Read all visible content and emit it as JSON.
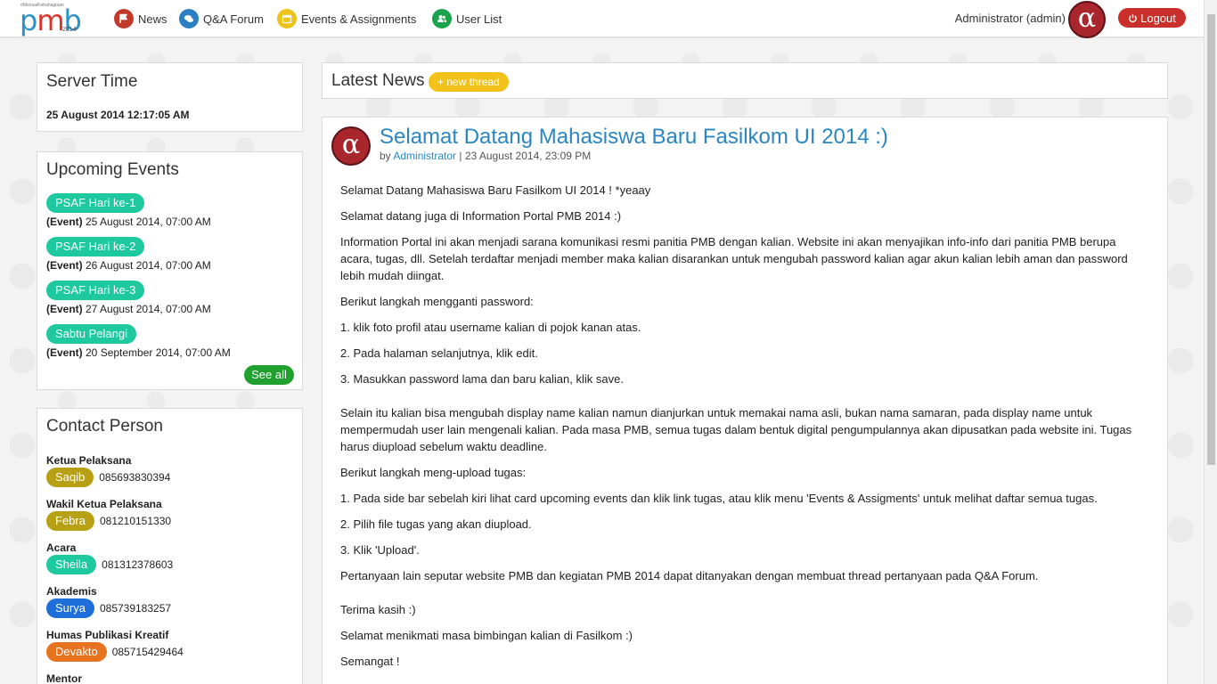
{
  "nav": {
    "logo_tagline": "#MenuaiKebahagiaan",
    "logo_p": "p",
    "logo_m": "m",
    "logo_b": "b",
    "logo_year": "2014",
    "items": [
      {
        "label": "News",
        "icon": "flag-icon"
      },
      {
        "label": "Q&A Forum",
        "icon": "chat-bubbles-icon"
      },
      {
        "label": "Events & Assignments",
        "icon": "calendar-icon"
      },
      {
        "label": "User List",
        "icon": "users-icon"
      }
    ],
    "admin_name": "Administrator (admin)",
    "avatar_glyph": "α",
    "logout_label": "Logout"
  },
  "server_time": {
    "title": "Server Time",
    "value": "25 August 2014 12:17:05 AM"
  },
  "events": {
    "title": "Upcoming Events",
    "items": [
      {
        "name": "PSAF Hari ke-1",
        "type": "(Event)",
        "date": " 25 August 2014, 07:00 AM"
      },
      {
        "name": "PSAF Hari ke-2",
        "type": "(Event)",
        "date": " 26 August 2014, 07:00 AM"
      },
      {
        "name": "PSAF Hari ke-3",
        "type": "(Event)",
        "date": " 27 August 2014, 07:00 AM"
      },
      {
        "name": "Sabtu Pelangi",
        "type": "(Event)",
        "date": " 20 September 2014, 07:00 AM"
      }
    ],
    "see_all": "See all"
  },
  "contacts": {
    "title": "Contact Person",
    "items": [
      {
        "role": "Ketua Pelaksana",
        "name": "Saqib",
        "phone": "085693830394",
        "color": "#b8a014"
      },
      {
        "role": "Wakil Ketua Pelaksana",
        "name": "Febra",
        "phone": "081210151330",
        "color": "#b8a014"
      },
      {
        "role": "Acara",
        "name": "Sheila",
        "phone": "081312378603",
        "color": "#1ec9a0"
      },
      {
        "role": "Akademis",
        "name": "Surya",
        "phone": "085739183257",
        "color": "#1e6fd9"
      },
      {
        "role": "Humas Publikasi Kreatif",
        "name": "Devakto",
        "phone": "085715429464",
        "color": "#e8731f"
      },
      {
        "role": "Mentor",
        "name": "",
        "phone": "",
        "color": "#b8a014"
      }
    ]
  },
  "news": {
    "title": "Latest News",
    "new_thread": "+ new thread"
  },
  "article": {
    "avatar_glyph": "α",
    "title": "Selamat Datang Mahasiswa Baru Fasilkom UI 2014 :)",
    "by": "by ",
    "author": "Administrator",
    "sep": " | ",
    "date": "23 August 2014, 23:09 PM",
    "paragraphs": [
      "Selamat Datang Mahasiswa Baru Fasilkom UI 2014 ! *yeaay",
      "Selamat datang juga di Information Portal PMB 2014 :)",
      "Information Portal ini akan menjadi sarana komunikasi resmi panitia PMB dengan kalian. Website ini akan menyajikan info-info dari panitia PMB berupa acara, tugas, dll. Setelah terdaftar menjadi member maka kalian disarankan untuk mengubah password kalian agar akun kalian lebih aman dan password lebih mudah diingat.",
      "Berikut langkah mengganti password:",
      "1. klik foto profil atau username kalian di pojok kanan atas.",
      "2. Pada halaman selanjutnya, klik edit.",
      "3. Masukkan password lama dan baru kalian, klik save.",
      "Selain itu kalian bisa mengubah display name kalian namun dianjurkan untuk memakai nama asli, bukan nama samaran, pada display name untuk mempermudah user lain mengenali kalian. Pada masa PMB, semua tugas dalam bentuk digital pengumpulannya akan dipusatkan pada website ini. Tugas harus diupload sebelum waktu deadline.",
      "Berikut langkah meng-upload tugas:",
      "1. Pada side bar sebelah kiri lihat card upcoming events dan klik link tugas, atau klik menu 'Events & Assigments' untuk melihat daftar semua tugas.",
      "2. Pilih file tugas yang akan diupload.",
      "3. Klik 'Upload'.",
      "Pertanyaan lain seputar website PMB dan kegiatan PMB 2014 dapat ditanyakan dengan membuat thread pertanyaan pada Q&A Forum.",
      "Terima kasih :)",
      "Selamat menikmati masa bimbingan kalian di Fasilkom :)",
      "Semangat !"
    ]
  }
}
